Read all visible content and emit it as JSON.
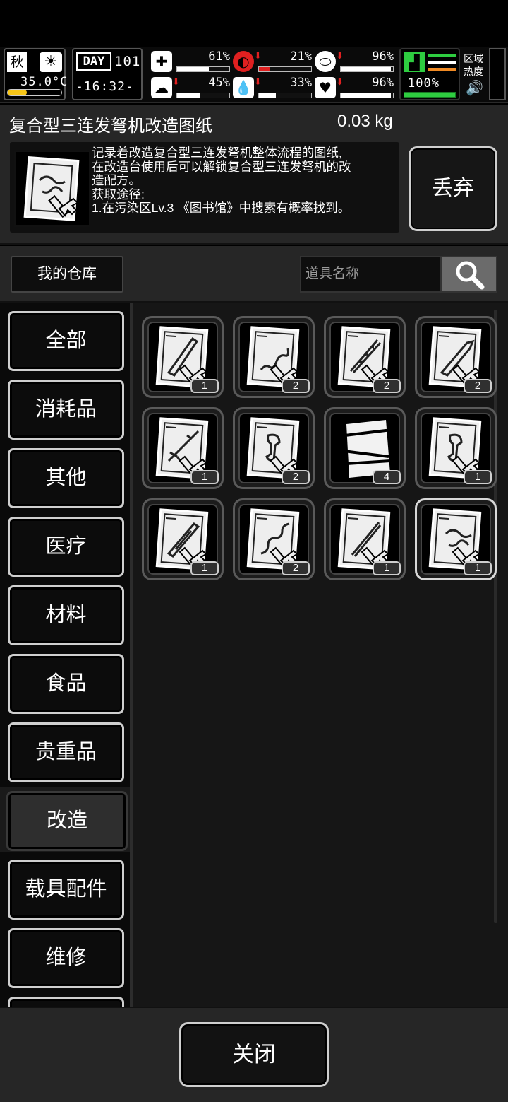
{
  "status": {
    "season": "秋",
    "temperature": "35.0°C",
    "day_label": "DAY",
    "day": "101",
    "time": "-16:32-",
    "stats": [
      {
        "name": "health",
        "icon": "medkit-icon",
        "value": "61%",
        "fill": 0.61,
        "drop": false
      },
      {
        "name": "hunger",
        "icon": "stomach-icon",
        "value": "21%",
        "fill": 0.21,
        "drop": true
      },
      {
        "name": "medicine",
        "icon": "pill-icon",
        "value": "96%",
        "fill": 0.96,
        "drop": true
      },
      {
        "name": "mood",
        "icon": "brain-icon",
        "value": "45%",
        "fill": 0.45,
        "drop": true
      },
      {
        "name": "thirst",
        "icon": "water-drop-icon",
        "value": "33%",
        "fill": 0.33,
        "drop": true
      },
      {
        "name": "heart",
        "icon": "heart-icon",
        "value": "96%",
        "fill": 0.96,
        "drop": true
      }
    ],
    "stamina": "100%",
    "zone_heat_label_1": "区域",
    "zone_heat_label_2": "热度"
  },
  "item": {
    "name": "复合型三连发弩机改造图纸",
    "weight": "0.03 kg",
    "description": [
      "记录着改造复合型三连发弩机整体流程的图纸,",
      "在改造台使用后可以解锁复合型三连发弩机的改",
      "造配方。",
      "获取途径:",
      "1.在污染区Lv.3 《图书馆》中搜索有概率找到。"
    ],
    "discard_label": "丢弃"
  },
  "warehouse": {
    "title": "我的仓库",
    "search_placeholder": "道具名称"
  },
  "categories": [
    {
      "label": "全部",
      "active": false
    },
    {
      "label": "消耗品",
      "active": false
    },
    {
      "label": "其他",
      "active": false
    },
    {
      "label": "医疗",
      "active": false
    },
    {
      "label": "材料",
      "active": false
    },
    {
      "label": "食品",
      "active": false
    },
    {
      "label": "贵重品",
      "active": false
    },
    {
      "label": "改造",
      "active": true
    },
    {
      "label": "载具配件",
      "active": false
    },
    {
      "label": "维修",
      "active": false
    }
  ],
  "items": [
    {
      "icon": "blueprint-sword-icon",
      "count": "1"
    },
    {
      "icon": "blueprint-coil-icon",
      "count": "2"
    },
    {
      "icon": "blueprint-saw-blade-icon",
      "count": "2"
    },
    {
      "icon": "blueprint-machete-icon",
      "count": "2"
    },
    {
      "icon": "blueprint-spear-icon",
      "count": "1"
    },
    {
      "icon": "blueprint-trigger-icon",
      "count": "2"
    },
    {
      "icon": "torn-paper-icon",
      "count": "4"
    },
    {
      "icon": "blueprint-trigger-icon",
      "count": "1"
    },
    {
      "icon": "blueprint-blade-icon",
      "count": "1"
    },
    {
      "icon": "blueprint-chain-icon",
      "count": "2"
    },
    {
      "icon": "blueprint-katana-icon",
      "count": "1"
    },
    {
      "icon": "blueprint-crossbow-icon",
      "count": "1",
      "selected": true
    }
  ],
  "close_label": "关闭"
}
